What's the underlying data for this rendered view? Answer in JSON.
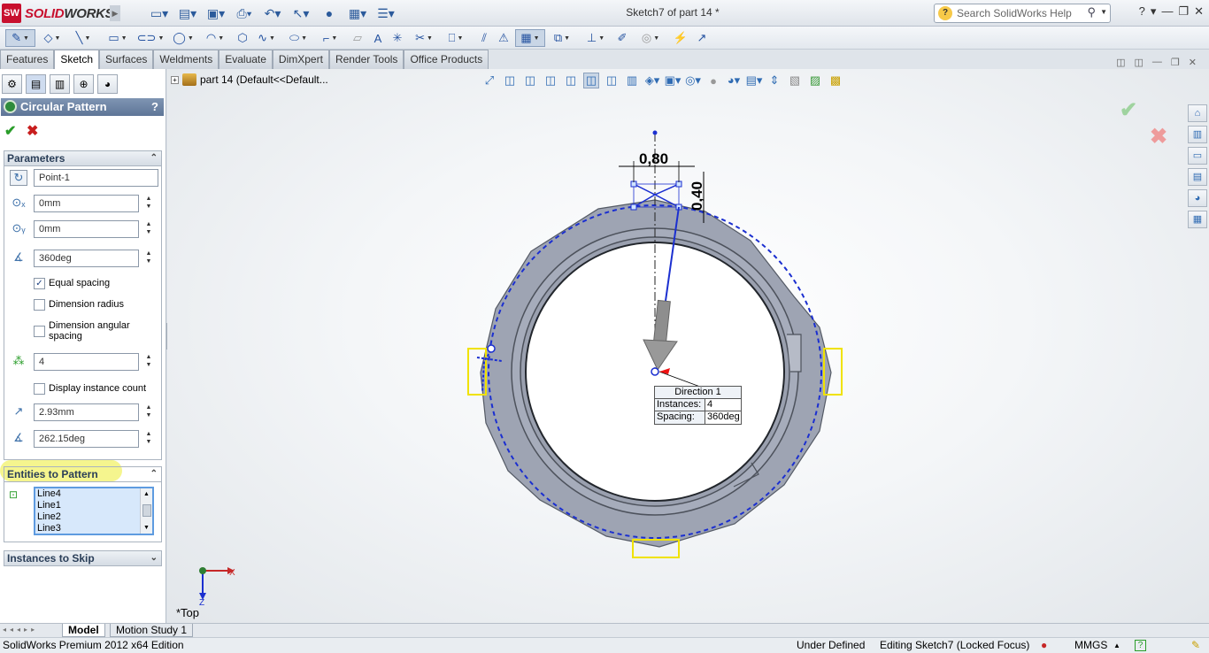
{
  "app": {
    "brand_prefix": "SOLID",
    "brand_suffix": "WORKS",
    "doc_title": "Sketch7 of part 14 *"
  },
  "search": {
    "placeholder": "Search SolidWorks Help"
  },
  "tabs": [
    "Features",
    "Sketch",
    "Surfaces",
    "Weldments",
    "Evaluate",
    "DimXpert",
    "Render Tools",
    "Office Products"
  ],
  "property_manager": {
    "title": "Circular Pattern",
    "help": "?",
    "parameters_header": "Parameters",
    "center_point": "Point-1",
    "center_x": "0mm",
    "center_y": "0mm",
    "angle": "360deg",
    "equal_spacing": "Equal spacing",
    "dimension_radius": "Dimension radius",
    "dimension_angular_spacing": "Dimension angular spacing",
    "instances": "4",
    "display_instance_count": "Display instance count",
    "radius": "2.93mm",
    "arc_angle": "262.15deg",
    "entities_header": "Entities to Pattern",
    "entities": [
      "Line4",
      "Line1",
      "Line2",
      "Line3"
    ],
    "skip_header": "Instances to Skip"
  },
  "tree": {
    "label": "part 14  (Default<<Default..."
  },
  "viewport": {
    "dim_horizontal": "0,80",
    "dim_vertical": "0,40",
    "callout_title": "Direction 1",
    "callout_instances_label": "Instances:",
    "callout_instances": "4",
    "callout_spacing_label": "Spacing:",
    "callout_spacing": "360deg",
    "view_name": "*Top",
    "axis_x": "X",
    "axis_z": "Z"
  },
  "bottom_tabs": {
    "model": "Model",
    "motion": "Motion Study 1"
  },
  "status": {
    "edition": "SolidWorks Premium 2012 x64 Edition",
    "state": "Under Defined",
    "editing": "Editing Sketch7 (Locked Focus)",
    "units": "MMGS"
  }
}
